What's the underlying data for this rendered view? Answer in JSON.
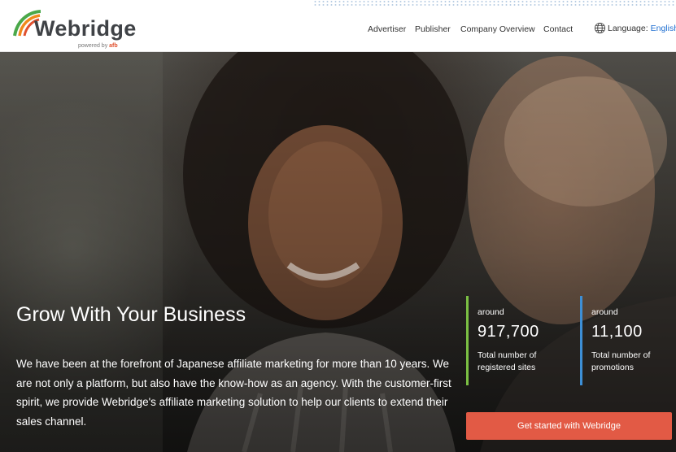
{
  "brand": {
    "name": "Webridge",
    "tagline_prefix": "powered by",
    "tagline_brand": "afb"
  },
  "nav": {
    "items": [
      {
        "label": "Advertiser"
      },
      {
        "label": "Publisher"
      },
      {
        "label": "Company Overview"
      },
      {
        "label": "Contact"
      }
    ],
    "language_label": "Language:",
    "language_value": "English"
  },
  "hero": {
    "title": "Grow With Your Business",
    "body": "We have been at the forefront of Japanese affiliate marketing for more than 10 years. We are not only a platform, but also have the know-how as an agency. With the customer-first spirit, we provide Webridge's affiliate marketing solution to help our clients to extend their sales channel."
  },
  "stats": [
    {
      "prefix": "around",
      "value": "917,700",
      "label": "Total number of registered sites",
      "accent": "#7bc043"
    },
    {
      "prefix": "around",
      "value": "11,100",
      "label": "Total number of promotions",
      "accent": "#3d8fd6"
    }
  ],
  "cta": {
    "label": "Get started with Webridge",
    "color": "#e25a45"
  },
  "colors": {
    "link": "#1f6fd0",
    "logo_orange": "#f08a1c",
    "logo_green": "#4aa84a",
    "logo_red": "#e0502e"
  }
}
